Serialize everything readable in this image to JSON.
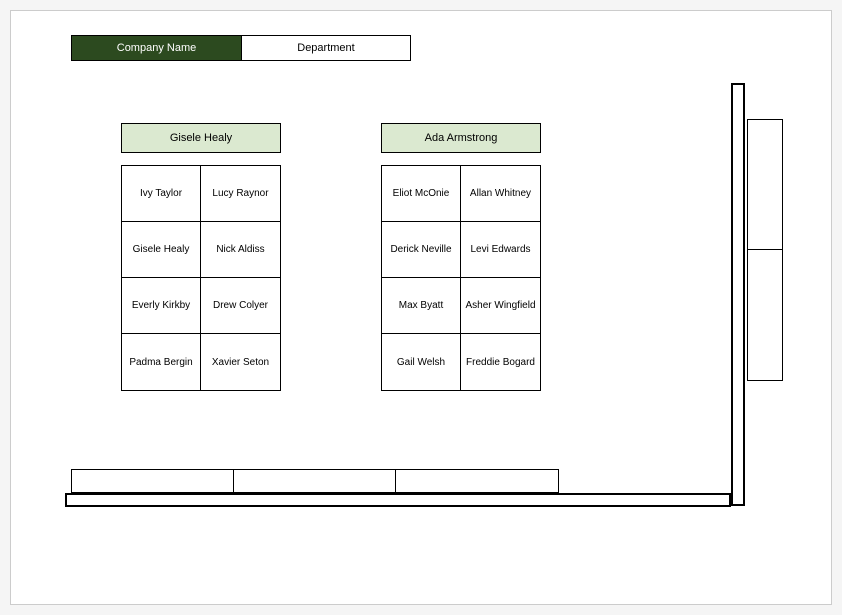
{
  "header": {
    "company_label": "Company Name",
    "department_label": "Department"
  },
  "teams": [
    {
      "lead": "Gisele Healy",
      "members": [
        "Ivy Taylor",
        "Lucy Raynor",
        "Gisele Healy",
        "Nick Aldiss",
        "Everly Kirkby",
        "Drew Colyer",
        "Padma Bergin",
        "Xavier Seton"
      ]
    },
    {
      "lead": "Ada Armstrong",
      "members": [
        "Eliot McOnie",
        "Allan Whitney",
        "Derick Neville",
        "Levi Edwards",
        "Max Byatt",
        "Asher Wingfield",
        "Gail Welsh",
        "Freddie Bogard"
      ]
    }
  ]
}
